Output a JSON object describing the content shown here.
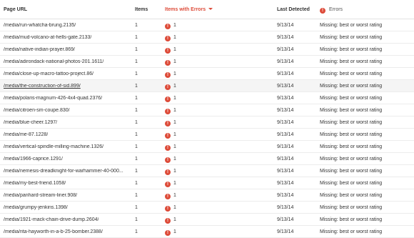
{
  "headers": {
    "page_url": "Page URL",
    "items": "Items",
    "items_with_errors": "Items with Errors",
    "last_detected": "Last Detected",
    "errors": "Errors",
    "error_icon_glyph": "!"
  },
  "rows": [
    {
      "url": "/media/run-whatcha-brung.2135/",
      "items": "1",
      "errors_count": "1",
      "last_detected": "9/13/14",
      "error": "Missing: best or worst rating"
    },
    {
      "url": "/media/mud-volcano-at-hells-gate.2133/",
      "items": "1",
      "errors_count": "1",
      "last_detected": "9/13/14",
      "error": "Missing: best or worst rating"
    },
    {
      "url": "/media/native-indian-prayer.869/",
      "items": "1",
      "errors_count": "1",
      "last_detected": "9/13/14",
      "error": "Missing: best or worst rating"
    },
    {
      "url": "/media/adirondack-national-photos-201.1611/",
      "items": "1",
      "errors_count": "1",
      "last_detected": "9/13/14",
      "error": "Missing: best or worst rating"
    },
    {
      "url": "/media/close-up-macro-tattoo-project.86/",
      "items": "1",
      "errors_count": "1",
      "last_detected": "9/13/14",
      "error": "Missing: best or worst rating"
    },
    {
      "url": "/media/the-construction-of-sid.899/",
      "items": "1",
      "errors_count": "1",
      "last_detected": "9/13/14",
      "error": "Missing: best or worst rating"
    },
    {
      "url": "/media/polaris-magnum-426-4x4-quad.2376/",
      "items": "1",
      "errors_count": "1",
      "last_detected": "9/13/14",
      "error": "Missing: best or worst rating"
    },
    {
      "url": "/media/citroen-sm-coupe.830/",
      "items": "1",
      "errors_count": "1",
      "last_detected": "9/13/14",
      "error": "Missing: best or worst rating"
    },
    {
      "url": "/media/blue-cheer.1297/",
      "items": "1",
      "errors_count": "1",
      "last_detected": "9/13/14",
      "error": "Missing: best or worst rating"
    },
    {
      "url": "/media/me-87.1228/",
      "items": "1",
      "errors_count": "1",
      "last_detected": "9/13/14",
      "error": "Missing: best or worst rating"
    },
    {
      "url": "/media/vertical-spindle-milling-machine.1326/",
      "items": "1",
      "errors_count": "1",
      "last_detected": "9/13/14",
      "error": "Missing: best or worst rating"
    },
    {
      "url": "/media/1966-caprice.1291/",
      "items": "1",
      "errors_count": "1",
      "last_detected": "9/13/14",
      "error": "Missing: best or worst rating"
    },
    {
      "url": "/media/nemesis-dreadknight-for-warhammer-40-000...",
      "items": "1",
      "errors_count": "1",
      "last_detected": "9/13/14",
      "error": "Missing: best or worst rating"
    },
    {
      "url": "/media/my-best-friend.1058/",
      "items": "1",
      "errors_count": "1",
      "last_detected": "9/13/14",
      "error": "Missing: best or worst rating"
    },
    {
      "url": "/media/panhard-stream-liner.908/",
      "items": "1",
      "errors_count": "1",
      "last_detected": "9/13/14",
      "error": "Missing: best or worst rating"
    },
    {
      "url": "/media/grumpy-jenkins.1398/",
      "items": "1",
      "errors_count": "1",
      "last_detected": "9/13/14",
      "error": "Missing: best or worst rating"
    },
    {
      "url": "/media/1921-mack-chain-drive-dump.2604/",
      "items": "1",
      "errors_count": "1",
      "last_detected": "9/13/14",
      "error": "Missing: best or worst rating"
    },
    {
      "url": "/media/rita-hayworth-in-a-b-25-bomber.2388/",
      "items": "1",
      "errors_count": "1",
      "last_detected": "9/13/14",
      "error": "Missing: best or worst rating"
    }
  ],
  "highlighted_row": 5,
  "colors": {
    "error_red": "#dd4b39",
    "highlight_bg": "#f5f5f5",
    "divider": "#ececec"
  }
}
